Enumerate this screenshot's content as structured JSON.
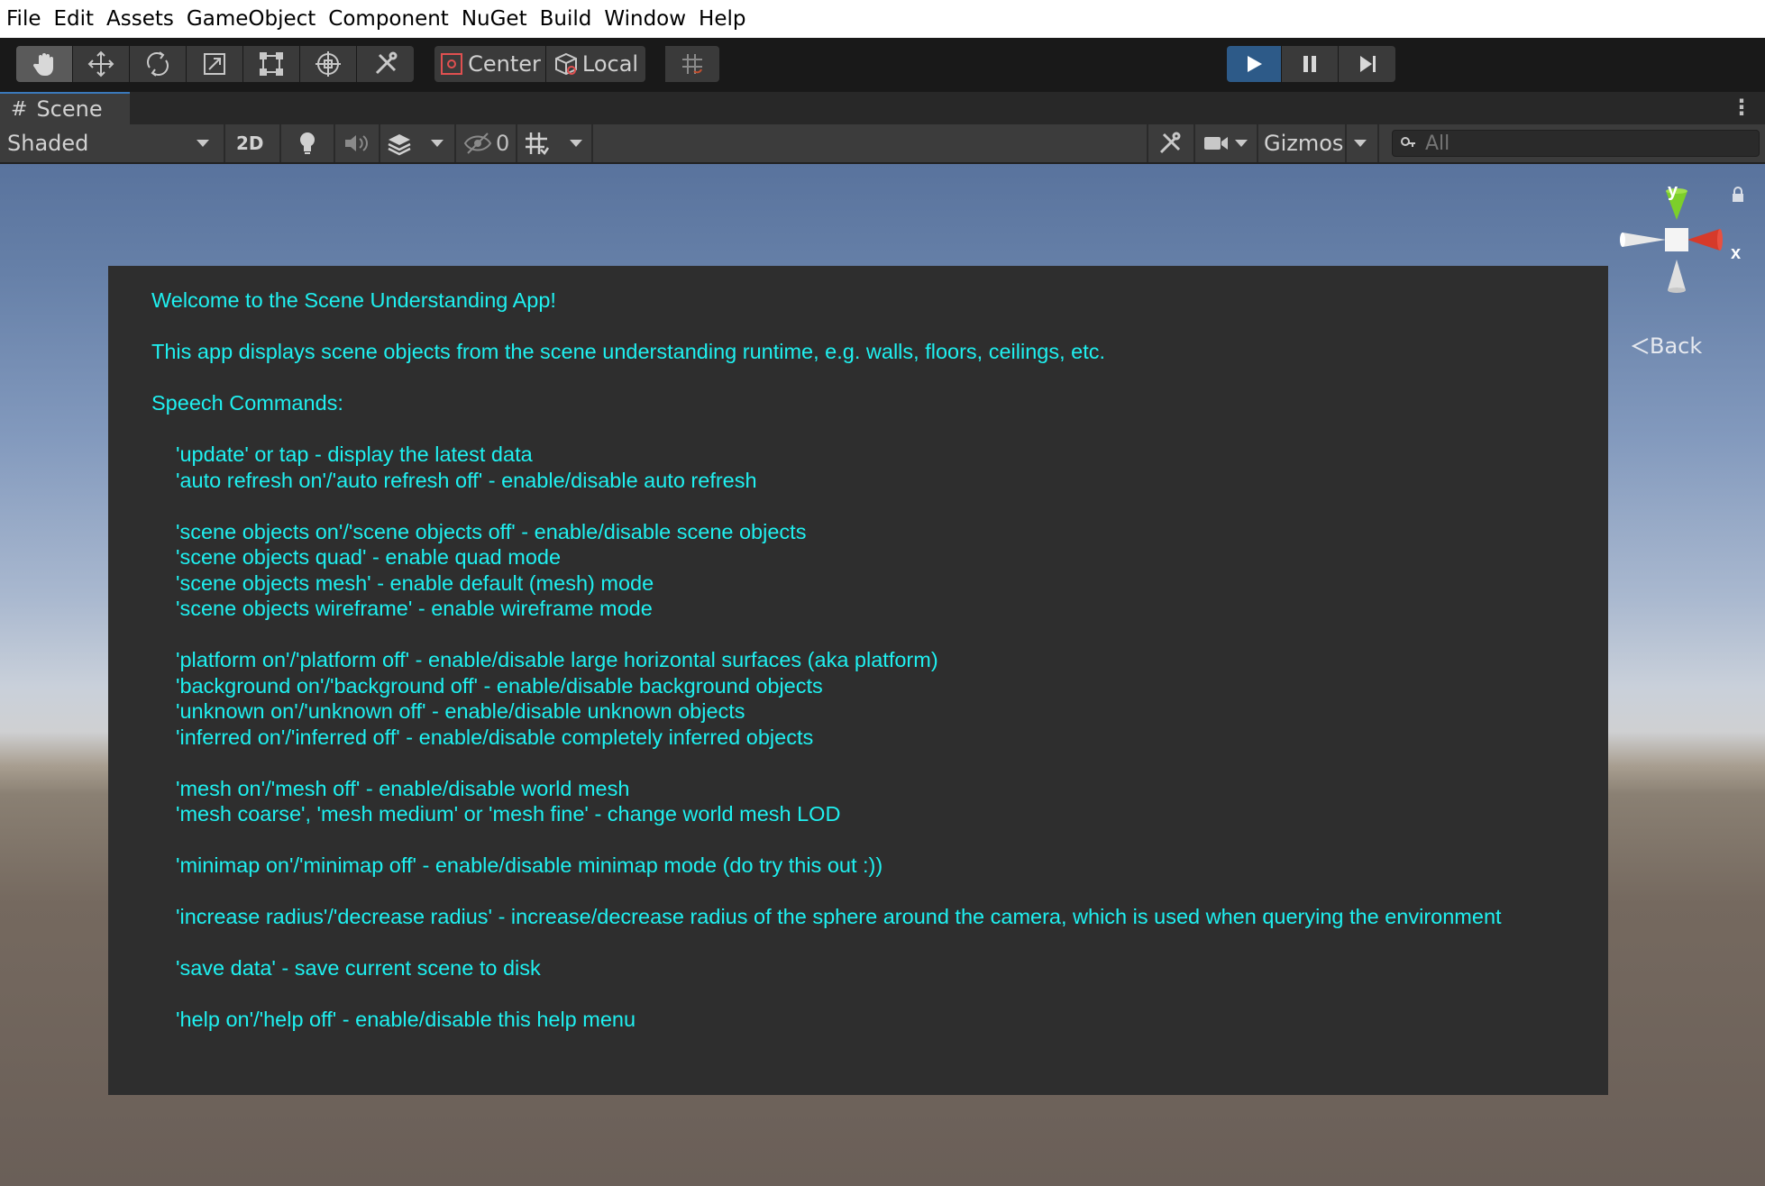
{
  "menu": [
    "File",
    "Edit",
    "Assets",
    "GameObject",
    "Component",
    "NuGet",
    "Build",
    "Window",
    "Help"
  ],
  "toolbar": {
    "tools": [
      "hand-tool",
      "move-tool",
      "rotate-tool",
      "scale-tool",
      "rect-tool",
      "transform-tool",
      "custom-tool"
    ],
    "pivot_mode": "Center",
    "pivot_rotation": "Local",
    "playback": [
      "play",
      "pause",
      "step"
    ],
    "play_active": true
  },
  "scene_tab": {
    "label": "Scene"
  },
  "scene_toolbar": {
    "draw_mode": "Shaded",
    "mode_2d": "2D",
    "hidden_count": "0",
    "gizmos_label": "Gizmos",
    "search_placeholder": "All"
  },
  "gizmo": {
    "y_label": "y",
    "x_label": "x",
    "back_label": "Back"
  },
  "help": {
    "lines": [
      "Welcome to the Scene Understanding App!",
      "This app displays scene objects from the scene understanding runtime, e.g. walls, floors, ceilings, etc.",
      "Speech Commands:",
      "'update' or tap - display the latest data",
      "'auto refresh on'/'auto refresh off' - enable/disable auto refresh",
      "'scene objects on'/'scene objects off' - enable/disable scene objects",
      "'scene objects quad' - enable quad mode",
      "'scene objects mesh' - enable default (mesh) mode",
      "'scene objects wireframe' - enable wireframe mode",
      "'platform on'/'platform off' - enable/disable large horizontal surfaces (aka platform)",
      "'background on'/'background off' - enable/disable background objects",
      "'unknown on'/'unknown off' - enable/disable unknown objects",
      "'inferred on'/'inferred off' - enable/disable completely inferred objects",
      "'mesh on'/'mesh off' - enable/disable world mesh",
      "'mesh coarse', 'mesh medium' or 'mesh fine' - change world mesh LOD",
      "'minimap on'/'minimap off' - enable/disable minimap mode (do try this out :))",
      "'increase radius'/'decrease radius' - increase/decrease radius of the sphere around the camera, which is used when querying the environment",
      "'save data' - save current scene to disk",
      "'help on'/'help off' - enable/disable this help menu"
    ]
  },
  "colors": {
    "help_text": "#1ff0f0",
    "help_panel_bg": "#2e2e2e",
    "play_active": "#2d5a88"
  }
}
